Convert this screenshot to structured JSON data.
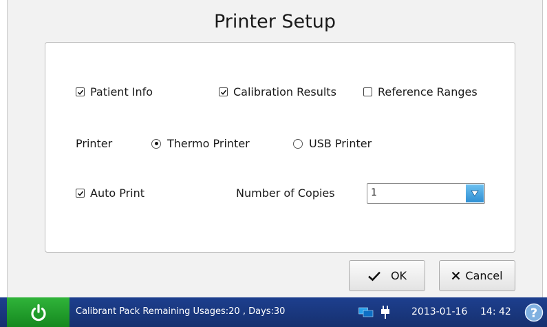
{
  "dialog": {
    "title": "Printer Setup",
    "options": {
      "patient_info": {
        "label": "Patient Info",
        "checked": true
      },
      "calibration_results": {
        "label": "Calibration Results",
        "checked": true
      },
      "reference_ranges": {
        "label": "Reference Ranges",
        "checked": false
      }
    },
    "printer": {
      "label": "Printer",
      "thermo": {
        "label": "Thermo Printer",
        "selected": true
      },
      "usb": {
        "label": "USB Printer",
        "selected": false
      }
    },
    "auto_print": {
      "label": "Auto Print",
      "checked": true
    },
    "copies": {
      "label": "Number of Copies",
      "value": "1"
    },
    "buttons": {
      "ok": "OK",
      "cancel": "Cancel"
    }
  },
  "status_bar": {
    "message": "Calibrant Pack Remaining Usages:20 , Days:30",
    "date": "2013-01-16",
    "time": "14: 42"
  },
  "colors": {
    "accent_blue": "#2f8fd3",
    "status_bar": "#1d3f8e",
    "power_green": "#1f9a2a"
  }
}
